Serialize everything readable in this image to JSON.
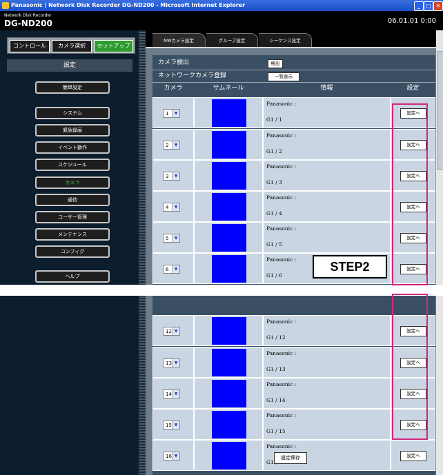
{
  "window": {
    "title": "Panasonic | Network Disk Recorder DG-ND200 - Microsoft Internet Explorer"
  },
  "header": {
    "subtitle": "Network Disk Recorder",
    "model": "DG-ND200",
    "datetime": "06.01.01  0:00"
  },
  "sidebar": {
    "top_tabs": [
      "コントロール",
      "カメラ選択",
      "セットアップ"
    ],
    "heading": "設定",
    "items": [
      "簡単設定",
      "システム",
      "緊急録画",
      "イベント動作",
      "スケジュール",
      "カメラ",
      "通信",
      "ユーザー管理",
      "メンテナンス",
      "コンフィグ",
      "ヘルプ"
    ]
  },
  "panel_tabs": [
    "NWカメラ設定",
    "グループ設定",
    "シーケンス設定"
  ],
  "camera_detect": {
    "label": "カメラ検出",
    "button": "検出"
  },
  "network_register": {
    "label": "ネットワークカメラ登録",
    "button": "一覧表示"
  },
  "table": {
    "headers": [
      "カメラ",
      "サムネール",
      "情報",
      "設定"
    ],
    "rows": [
      {
        "camera": "1",
        "maker": "Panasonic :",
        "group": "G1 / 1",
        "button": "設定へ"
      },
      {
        "camera": "2",
        "maker": "Panasonic :",
        "group": "G1 / 2",
        "button": "設定へ"
      },
      {
        "camera": "3",
        "maker": "Panasonic :",
        "group": "G1 / 3",
        "button": "設定へ"
      },
      {
        "camera": "4",
        "maker": "Panasonic :",
        "group": "G1 / 4",
        "button": "設定へ"
      },
      {
        "camera": "5",
        "maker": "Panasonic :",
        "group": "G1 / 5",
        "button": "設定へ"
      },
      {
        "camera": "6",
        "maker": "Panasonic :",
        "group": "G1 / 6",
        "button": "設定へ"
      },
      {
        "camera": "12",
        "maker": "Panasonic :",
        "group": "G1 / 12",
        "button": "設定へ"
      },
      {
        "camera": "13",
        "maker": "Panasonic :",
        "group": "G1 / 13",
        "button": "設定へ"
      },
      {
        "camera": "14",
        "maker": "Panasonic :",
        "group": "G1 / 14",
        "button": "設定へ"
      },
      {
        "camera": "15",
        "maker": "Panasonic :",
        "group": "G1 / 15",
        "button": "設定へ"
      },
      {
        "camera": "16",
        "maker": "Panasonic :",
        "group": "G1 / 16",
        "button": "設定へ"
      }
    ]
  },
  "annotation": {
    "step": "STEP2"
  },
  "save_button": "設定保存",
  "colors": {
    "highlight": "#d4267f",
    "thumbnail": "#0000ff",
    "active_tab": "#2e9b2e"
  }
}
